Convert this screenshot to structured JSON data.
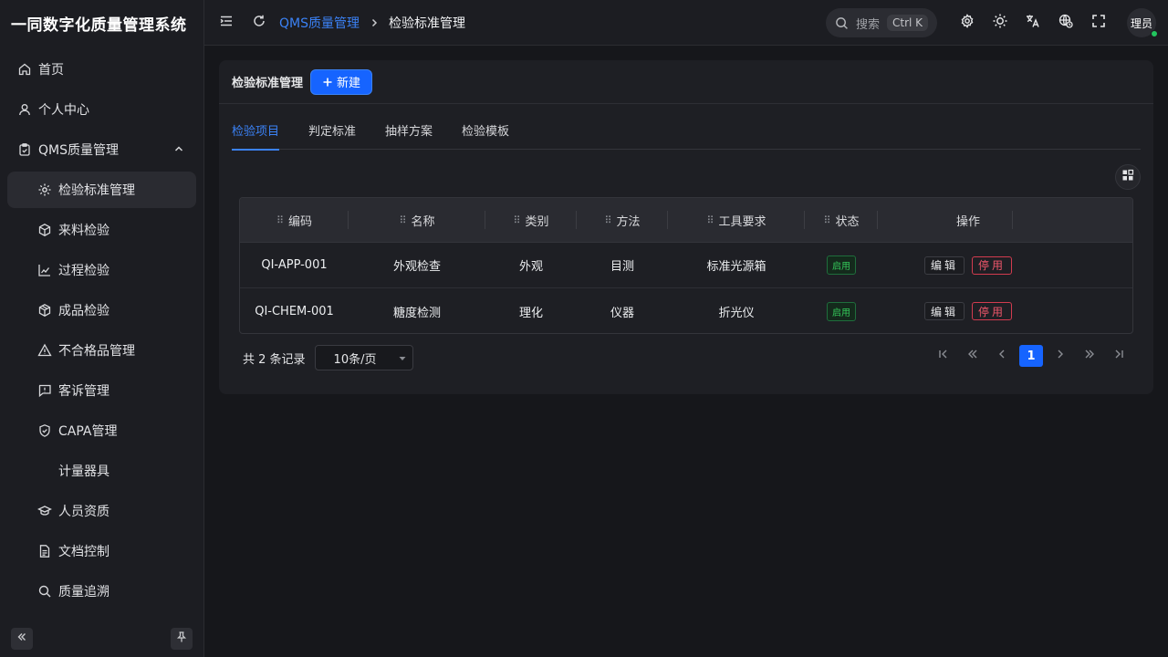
{
  "sidebar": {
    "brand": "一同数字化质量管理系统",
    "items": [
      {
        "label": "首页",
        "icon": "home-icon"
      },
      {
        "label": "个人中心",
        "icon": "user-icon"
      },
      {
        "label": "QMS质量管理",
        "icon": "clipboard-icon"
      },
      {
        "label": "检验标准管理",
        "icon": "gear-icon"
      },
      {
        "label": "来料检验",
        "icon": "box-icon"
      },
      {
        "label": "过程检验",
        "icon": "chart-icon"
      },
      {
        "label": "成品检验",
        "icon": "package-icon"
      },
      {
        "label": "不合格品管理",
        "icon": "warning-icon"
      },
      {
        "label": "客诉管理",
        "icon": "message-alert-icon"
      },
      {
        "label": "CAPA管理",
        "icon": "shield-icon"
      },
      {
        "label": "计量器具",
        "icon": ""
      },
      {
        "label": "人员资质",
        "icon": "graduation-cap-icon"
      },
      {
        "label": "文档控制",
        "icon": "document-icon"
      },
      {
        "label": "质量追溯",
        "icon": "search-icon"
      }
    ]
  },
  "header": {
    "breadcrumb_parent": "QMS质量管理",
    "breadcrumb_current": "检验标准管理",
    "search_placeholder": "搜索",
    "search_shortcut": "Ctrl K",
    "avatar_text": "理员"
  },
  "card": {
    "title": "检验标准管理",
    "new_button": "新建",
    "tabs": [
      "检验项目",
      "判定标准",
      "抽样方案",
      "检验模板"
    ]
  },
  "table": {
    "columns": [
      "编码",
      "名称",
      "类别",
      "方法",
      "工具要求",
      "状态",
      "操作"
    ],
    "rows": [
      {
        "code": "QI-APP-001",
        "name": "外观检查",
        "category": "外观",
        "method": "目测",
        "tool": "标准光源箱",
        "status": "启用"
      },
      {
        "code": "QI-CHEM-001",
        "name": "糖度检测",
        "category": "理化",
        "method": "仪器",
        "tool": "折光仪",
        "status": "启用"
      }
    ],
    "edit_label": "编辑",
    "disable_label": "停用"
  },
  "pagination": {
    "total_text": "共 2 条记录",
    "page_size": "10条/页",
    "current_page": "1"
  },
  "colors": {
    "accent": "#1664ff",
    "status_on": "#34c759",
    "danger": "#f0576b"
  }
}
